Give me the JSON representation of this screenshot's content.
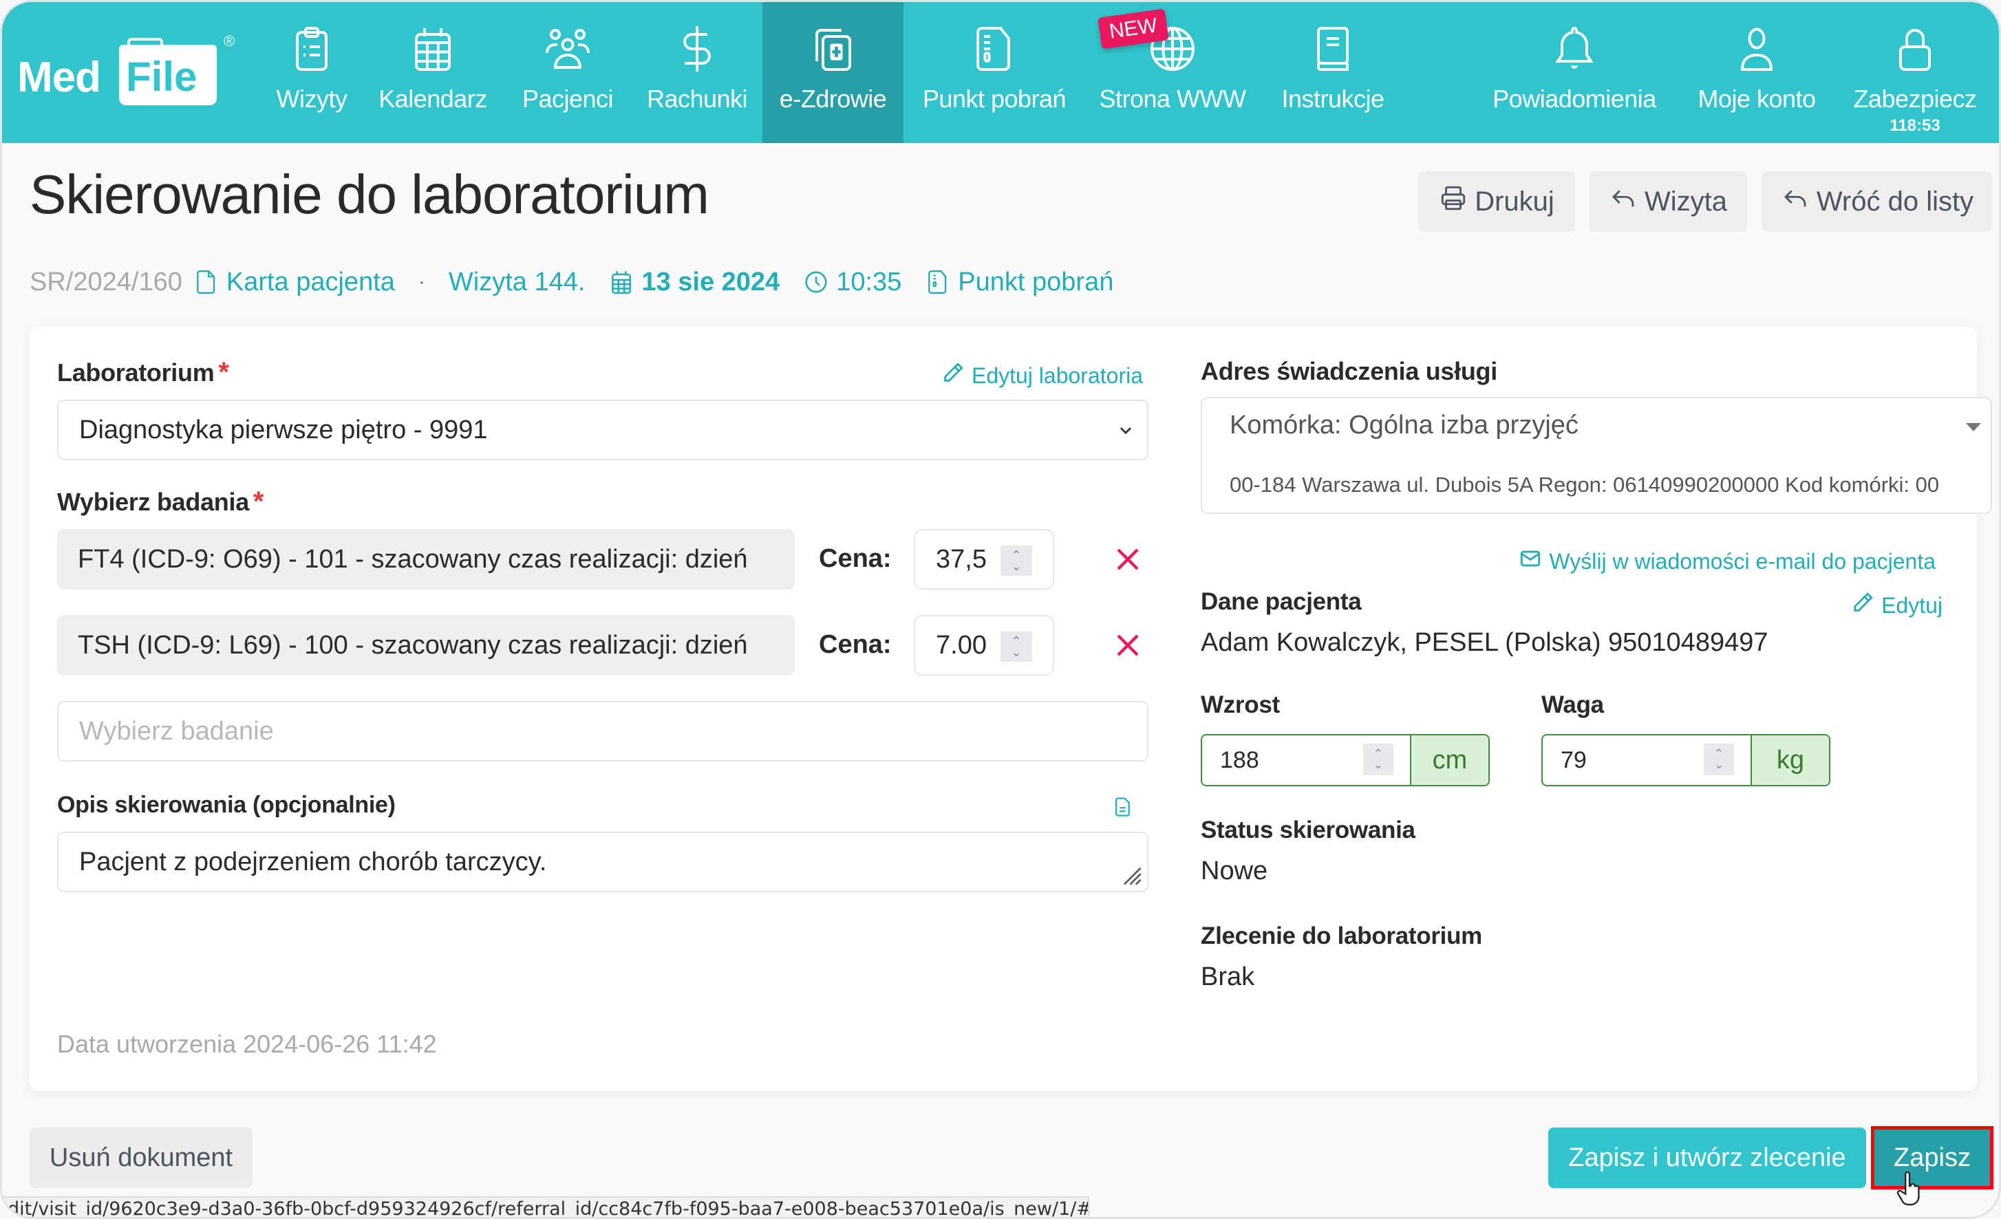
{
  "brand": {
    "name_part1": "Med",
    "name_part2": "File",
    "registered": "®"
  },
  "nav": {
    "items": [
      {
        "label": "Wizyty",
        "icon": "clipboard-list-icon"
      },
      {
        "label": "Kalendarz",
        "icon": "calendar-icon"
      },
      {
        "label": "Pacjenci",
        "icon": "users-icon"
      },
      {
        "label": "Rachunki",
        "icon": "dollar-icon"
      },
      {
        "label": "e-Zdrowie",
        "icon": "medical-docs-icon",
        "active": true
      },
      {
        "label": "Punkt pobrań",
        "icon": "sample-doc-icon"
      },
      {
        "label": "Strona WWW",
        "icon": "globe-icon",
        "badge": "NEW"
      },
      {
        "label": "Instrukcje",
        "icon": "book-icon"
      },
      {
        "label": "Powiadomienia",
        "icon": "bell-icon"
      },
      {
        "label": "Moje konto",
        "icon": "user-icon"
      },
      {
        "label": "Zabezpiecz",
        "icon": "lock-icon",
        "sublabel": "118:53"
      }
    ]
  },
  "header": {
    "title": "Skierowanie do laboratorium",
    "buttons": {
      "print": "Drukuj",
      "visit": "Wizyta",
      "back": "Wróć do listy"
    }
  },
  "meta": {
    "number": "SR/2024/160",
    "patient_card": "Karta pacjenta",
    "separator": "·",
    "visit": "Wizyta 144.",
    "date": "13 sie 2024",
    "time": "10:35",
    "collection_point": "Punkt pobrań"
  },
  "form": {
    "laboratory": {
      "label": "Laboratorium",
      "required_mark": "*",
      "edit_link": "Edytuj laboratoria",
      "selected": "Diagnostyka pierwsze piętro - 9991"
    },
    "tests": {
      "label": "Wybierz badania",
      "required_mark": "*",
      "price_label": "Cena:",
      "items": [
        {
          "name": "FT4 (ICD-9: O69)  - 101 - szacowany czas realizacji: dzień",
          "price": "37,5"
        },
        {
          "name": "TSH (ICD-9: L69)  - 100 - szacowany czas realizacji: dzień",
          "price": "7.00"
        }
      ],
      "add_placeholder": "Wybierz badanie"
    },
    "description": {
      "label": "Opis skierowania (opcjonalnie)",
      "value": "Pacjent z podejrzeniem chorób tarczycy."
    },
    "created": "Data utworzenia 2024-06-26 11:42"
  },
  "right": {
    "address": {
      "label": "Adres świadczenia usługi",
      "line1": "Komórka: Ogólna izba przyjęć",
      "line2": "00-184 Warszawa ul. Dubois 5A Regon: 06140990200000 Kod komórki: 00"
    },
    "email_link": "Wyślij w wiadomości e-mail do pacjenta",
    "patient": {
      "label": "Dane pacjenta",
      "edit": "Edytuj",
      "value": "Adam Kowalczyk, PESEL (Polska) 95010489497"
    },
    "height": {
      "label": "Wzrost",
      "value": "188",
      "unit": "cm"
    },
    "weight": {
      "label": "Waga",
      "value": "79",
      "unit": "kg"
    },
    "status": {
      "label": "Status skierowania",
      "value": "Nowe"
    },
    "lab_order": {
      "label": "Zlecenie do laboratorium",
      "value": "Brak"
    }
  },
  "footer": {
    "delete": "Usuń dokument",
    "save_and_order": "Zapisz i utwórz zlecenie",
    "save": "Zapisz"
  },
  "status_bar_url": "dit/visit_id/9620c3e9-d3a0-36fb-0bcf-d959324926cf/referral_id/cc84c7fb-f095-baa7-e008-beac53701e0a/is_new/1/#",
  "colors": {
    "brand": "#30c4cc",
    "active_nav": "#279fa6",
    "link": "#25adb5",
    "danger": "#e8195e",
    "required": "#e53935",
    "highlight_border": "#ff0000"
  }
}
